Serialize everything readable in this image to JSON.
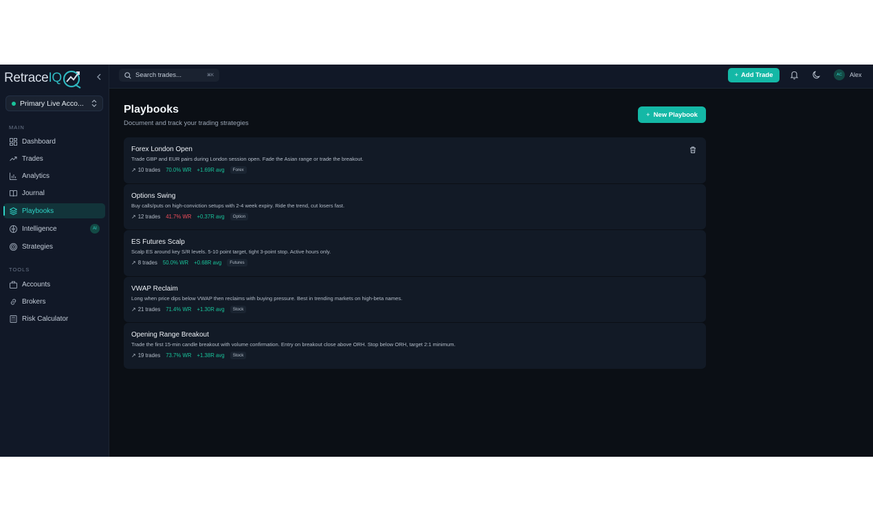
{
  "brand": {
    "logo_text": "Retrace",
    "logo_accent": "IQ"
  },
  "account_switcher": {
    "name": "Primary Live Acco...",
    "status_color": "#19c39a"
  },
  "sidebar": {
    "main_label": "MAIN",
    "main_items": [
      {
        "label": "Dashboard",
        "icon": "dashboard-icon"
      },
      {
        "label": "Trades",
        "icon": "trending-up-icon"
      },
      {
        "label": "Analytics",
        "icon": "bar-chart-icon"
      },
      {
        "label": "Journal",
        "icon": "book-icon"
      },
      {
        "label": "Playbooks",
        "icon": "layers-icon",
        "active": true
      },
      {
        "label": "Intelligence",
        "icon": "brain-icon",
        "badge": "AI"
      },
      {
        "label": "Strategies",
        "icon": "target-icon"
      }
    ],
    "tools_label": "TOOLS",
    "tools_items": [
      {
        "label": "Accounts",
        "icon": "briefcase-icon"
      },
      {
        "label": "Brokers",
        "icon": "link-icon"
      },
      {
        "label": "Risk Calculator",
        "icon": "calculator-icon"
      }
    ]
  },
  "topbar": {
    "search_placeholder": "Search trades...",
    "search_shortcut": "⌘K",
    "add_trade_label": "Add Trade",
    "user_initials": "AC",
    "user_name": "Alex"
  },
  "page": {
    "title": "Playbooks",
    "subtitle": "Document and track your trading strategies",
    "new_button_label": "New Playbook"
  },
  "playbooks": [
    {
      "title": "Forex London Open",
      "description": "Trade GBP and EUR pairs during London session open. Fade the Asian range or trade the breakout.",
      "trades": "10 trades",
      "win_rate": "70.0% WR",
      "wr_status": "good",
      "avg": "+1.69R avg",
      "tag": "Forex"
    },
    {
      "title": "Options Swing",
      "description": "Buy calls/puts on high-conviction setups with 2-4 week expiry. Ride the trend, cut losers fast.",
      "trades": "12 trades",
      "win_rate": "41.7% WR",
      "wr_status": "bad",
      "avg": "+0.37R avg",
      "tag": "Option"
    },
    {
      "title": "ES Futures Scalp",
      "description": "Scalp ES around key S/R levels. 5-10 point target, tight 3-point stop. Active hours only.",
      "trades": "8 trades",
      "win_rate": "50.0% WR",
      "wr_status": "good",
      "avg": "+0.68R avg",
      "tag": "Futures"
    },
    {
      "title": "VWAP Reclaim",
      "description": "Long when price dips below VWAP then reclaims with buying pressure. Best in trending markets on high-beta names.",
      "trades": "21 trades",
      "win_rate": "71.4% WR",
      "wr_status": "good",
      "avg": "+1.30R avg",
      "tag": "Stock"
    },
    {
      "title": "Opening Range Breakout",
      "description": "Trade the first 15-min candle breakout with volume confirmation. Entry on breakout close above ORH. Stop below ORH, target 2:1 minimum.",
      "trades": "19 trades",
      "win_rate": "73.7% WR",
      "wr_status": "good",
      "avg": "+1.38R avg",
      "tag": "Stock"
    }
  ],
  "colors": {
    "accent": "#14b8a6",
    "positive": "#19c39a",
    "negative": "#ef4d5a",
    "background": "#0b0f15",
    "sidebar": "#111827"
  }
}
